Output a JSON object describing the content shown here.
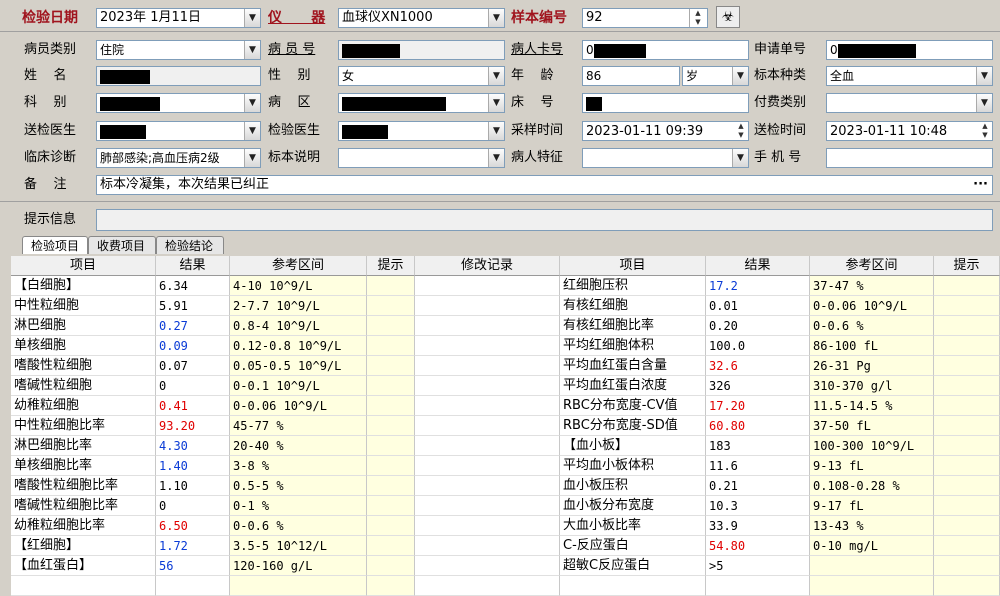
{
  "header": {
    "test_date_label": "检验日期",
    "test_date_value": "2023年 1月11日",
    "instrument_label": "仪      器",
    "instrument_value": "血球仪XN1000",
    "sample_no_label": "样本编号",
    "sample_no_value": "92"
  },
  "form": {
    "patient_type": {
      "label": "病员类别",
      "value": "住院"
    },
    "patient_no": {
      "label": "病 员 号"
    },
    "card_no": {
      "label": "病人卡号",
      "value": "0"
    },
    "request_no": {
      "label": "申请单号",
      "value": "0"
    },
    "name": {
      "label": "姓    名"
    },
    "gender": {
      "label": "性    别",
      "value": "女"
    },
    "age": {
      "label": "年    龄",
      "value": "86",
      "unit": "岁"
    },
    "specimen_type": {
      "label": "标本种类",
      "value": "全血"
    },
    "department": {
      "label": "科    别"
    },
    "ward": {
      "label": "病    区"
    },
    "bed": {
      "label": "床    号"
    },
    "payment": {
      "label": "付费类别",
      "value": ""
    },
    "sender": {
      "label": "送检医生"
    },
    "tester": {
      "label": "检验医生"
    },
    "sample_time": {
      "label": "采样时间",
      "value": "2023-01-11 09:39"
    },
    "send_time": {
      "label": "送检时间",
      "value": "2023-01-11 10:48"
    },
    "diagnosis": {
      "label": "临床诊断",
      "value": "肺部感染;高血压病2级"
    },
    "specimen_note": {
      "label": "标本说明",
      "value": ""
    },
    "patient_feature": {
      "label": "病人特征",
      "value": ""
    },
    "phone": {
      "label": "手 机 号",
      "value": ""
    },
    "remark": {
      "label": "备    注",
      "value": "标本冷凝集，本次结果已纠正"
    },
    "hint": {
      "label": "提示信息",
      "value": ""
    }
  },
  "tabs": [
    "检验项目",
    "收费项目",
    "检验结论"
  ],
  "columns_left": [
    "项目",
    "结果",
    "参考区间",
    "提示",
    "修改记录"
  ],
  "columns_right": [
    "项目",
    "结果",
    "参考区间",
    "提示"
  ],
  "rows_left": [
    {
      "item": "【白细胞】",
      "result": "6.34",
      "ref": "4-10 10^9/L",
      "flag": "norm"
    },
    {
      "item": "中性粒细胞",
      "result": "5.91",
      "ref": "2-7.7 10^9/L",
      "flag": "norm"
    },
    {
      "item": "淋巴细胞",
      "result": "0.27",
      "ref": "0.8-4 10^9/L",
      "flag": "low"
    },
    {
      "item": "单核细胞",
      "result": "0.09",
      "ref": "0.12-0.8 10^9/L",
      "flag": "low"
    },
    {
      "item": "嗜酸性粒细胞",
      "result": "0.07",
      "ref": "0.05-0.5 10^9/L",
      "flag": "norm"
    },
    {
      "item": "嗜碱性粒细胞",
      "result": "0",
      "ref": "0-0.1 10^9/L",
      "flag": "norm"
    },
    {
      "item": "幼稚粒细胞",
      "result": "0.41",
      "ref": "0-0.06 10^9/L",
      "flag": "high"
    },
    {
      "item": "中性粒细胞比率",
      "result": "93.20",
      "ref": "45-77 %",
      "flag": "high"
    },
    {
      "item": "淋巴细胞比率",
      "result": "4.30",
      "ref": "20-40 %",
      "flag": "low"
    },
    {
      "item": "单核细胞比率",
      "result": "1.40",
      "ref": "3-8 %",
      "flag": "low"
    },
    {
      "item": "嗜酸性粒细胞比率",
      "result": "1.10",
      "ref": "0.5-5 %",
      "flag": "norm"
    },
    {
      "item": "嗜碱性粒细胞比率",
      "result": "0",
      "ref": "0-1 %",
      "flag": "norm"
    },
    {
      "item": "幼稚粒细胞比率",
      "result": "6.50",
      "ref": "0-0.6 %",
      "flag": "high"
    },
    {
      "item": "【红细胞】",
      "result": "1.72",
      "ref": "3.5-5 10^12/L",
      "flag": "low"
    },
    {
      "item": "【血红蛋白】",
      "result": "56",
      "ref": "120-160 g/L",
      "flag": "low"
    }
  ],
  "rows_right": [
    {
      "item": "红细胞压积",
      "result": "17.2",
      "ref": "37-47 %",
      "flag": "low"
    },
    {
      "item": "有核红细胞",
      "result": "0.01",
      "ref": "0-0.06 10^9/L",
      "flag": "norm"
    },
    {
      "item": "有核红细胞比率",
      "result": "0.20",
      "ref": "0-0.6 %",
      "flag": "norm"
    },
    {
      "item": "平均红细胞体积",
      "result": "100.0",
      "ref": "86-100 fL",
      "flag": "norm"
    },
    {
      "item": "平均血红蛋白含量",
      "result": "32.6",
      "ref": "26-31 Pg",
      "flag": "high"
    },
    {
      "item": "平均血红蛋白浓度",
      "result": "326",
      "ref": "310-370 g/l",
      "flag": "norm"
    },
    {
      "item": "RBC分布宽度-CV值",
      "result": "17.20",
      "ref": "11.5-14.5 %",
      "flag": "high"
    },
    {
      "item": "RBC分布宽度-SD值",
      "result": "60.80",
      "ref": "37-50 fL",
      "flag": "high"
    },
    {
      "item": "【血小板】",
      "result": "183",
      "ref": "100-300 10^9/L",
      "flag": "norm"
    },
    {
      "item": "平均血小板体积",
      "result": "11.6",
      "ref": "9-13 fL",
      "flag": "norm"
    },
    {
      "item": "血小板压积",
      "result": "0.21",
      "ref": "0.108-0.28 %",
      "flag": "norm"
    },
    {
      "item": "血小板分布宽度",
      "result": "10.3",
      "ref": "9-17 fL",
      "flag": "norm"
    },
    {
      "item": "大血小板比率",
      "result": "33.9",
      "ref": "13-43 %",
      "flag": "norm"
    },
    {
      "item": "C-反应蛋白",
      "result": "54.80",
      "ref": "0-10 mg/L",
      "flag": "high"
    },
    {
      "item": "超敏C反应蛋白",
      "result": ">5",
      "ref": "",
      "flag": "norm"
    }
  ],
  "colors": {
    "high": "#e00000",
    "low": "#0a3bd6",
    "label_red": "#a0141e"
  },
  "icons": {
    "biohazard": "biohazard-icon",
    "dropdown": "chevron-down-icon",
    "more": "ellipsis-icon"
  }
}
